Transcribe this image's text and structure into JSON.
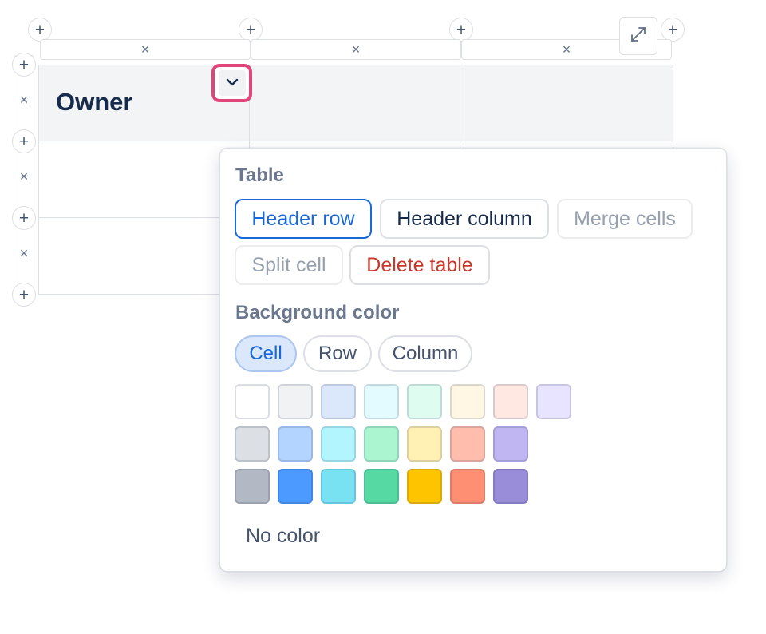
{
  "table": {
    "header_cell_text": "Owner",
    "remove_glyph": "×",
    "add_glyph": "+"
  },
  "icons": {
    "cell_menu": "chevron-down-icon",
    "expand": "expand-icon"
  },
  "colors": {
    "focus_ring": "#e2457a",
    "accent": "#1868db",
    "danger": "#c9372c"
  },
  "popup": {
    "table_section_title": "Table",
    "actions": [
      {
        "label": "Header row",
        "state": "active"
      },
      {
        "label": "Header column",
        "state": "normal"
      },
      {
        "label": "Merge cells",
        "state": "disabled"
      },
      {
        "label": "Split cell",
        "state": "disabled"
      },
      {
        "label": "Delete table",
        "state": "danger"
      }
    ],
    "background_section_title": "Background color",
    "targets": [
      {
        "label": "Cell",
        "selected": true
      },
      {
        "label": "Row",
        "selected": false
      },
      {
        "label": "Column",
        "selected": false
      }
    ],
    "swatches": [
      [
        "#ffffff",
        "#f1f2f4",
        "#dbe7fb",
        "#e3fbff",
        "#dffcf0",
        "#fff7e3",
        "#ffe8e2",
        "#e8e4ff"
      ],
      [
        "#dcdfe4",
        "#b3d4ff",
        "#b3f5ff",
        "#abf5d1",
        "#fff0b3",
        "#ffbdad",
        "#c0b6f2"
      ],
      [
        "#b3b9c4",
        "#4c9aff",
        "#79e2f2",
        "#57d9a3",
        "#ffc400",
        "#ff8f73",
        "#998dd9"
      ]
    ],
    "no_color_label": "No color"
  }
}
